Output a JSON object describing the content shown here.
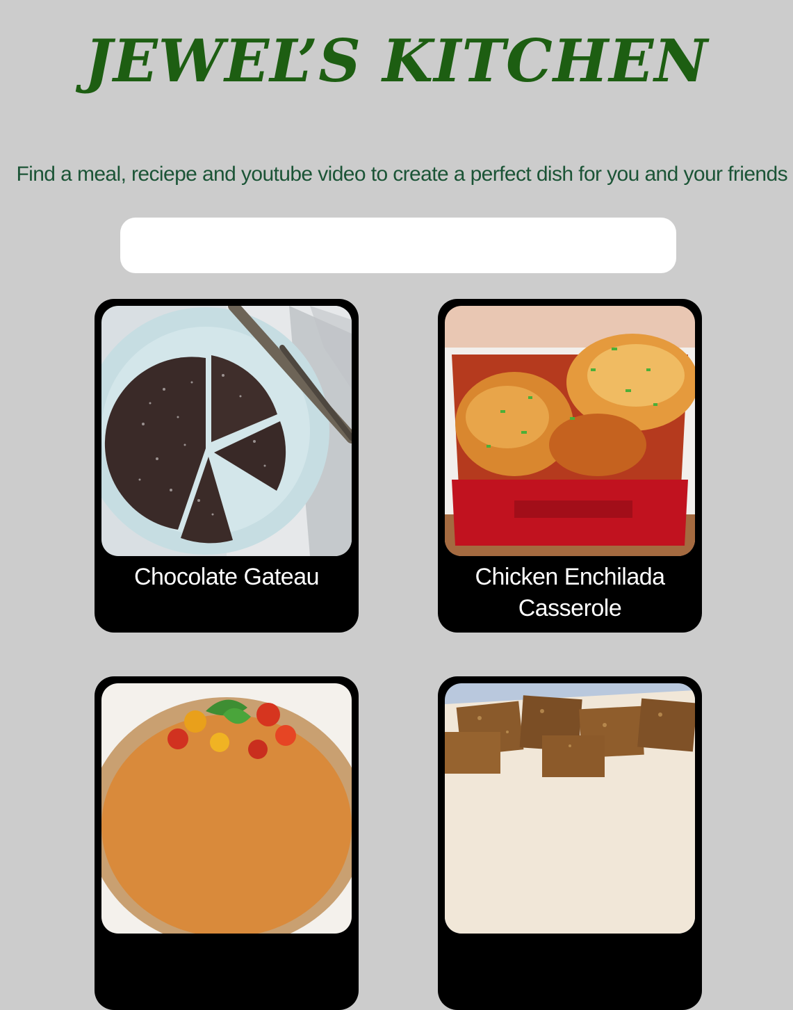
{
  "header": {
    "title": "JEWEL’S KITCHEN",
    "tagline": "Find a meal, reciepe and youtube video to create a perfect dish for you and your friends"
  },
  "search": {
    "value": "",
    "placeholder": ""
  },
  "meals": [
    {
      "name": "Chocolate Gateau"
    },
    {
      "name": "Chicken Enchilada Casserole"
    },
    {
      "name": ""
    },
    {
      "name": ""
    }
  ],
  "colors": {
    "background": "#cccccc",
    "title": "#1d5e12",
    "tagline": "#1b5436",
    "card": "#000000",
    "card_text": "#ffffff"
  }
}
